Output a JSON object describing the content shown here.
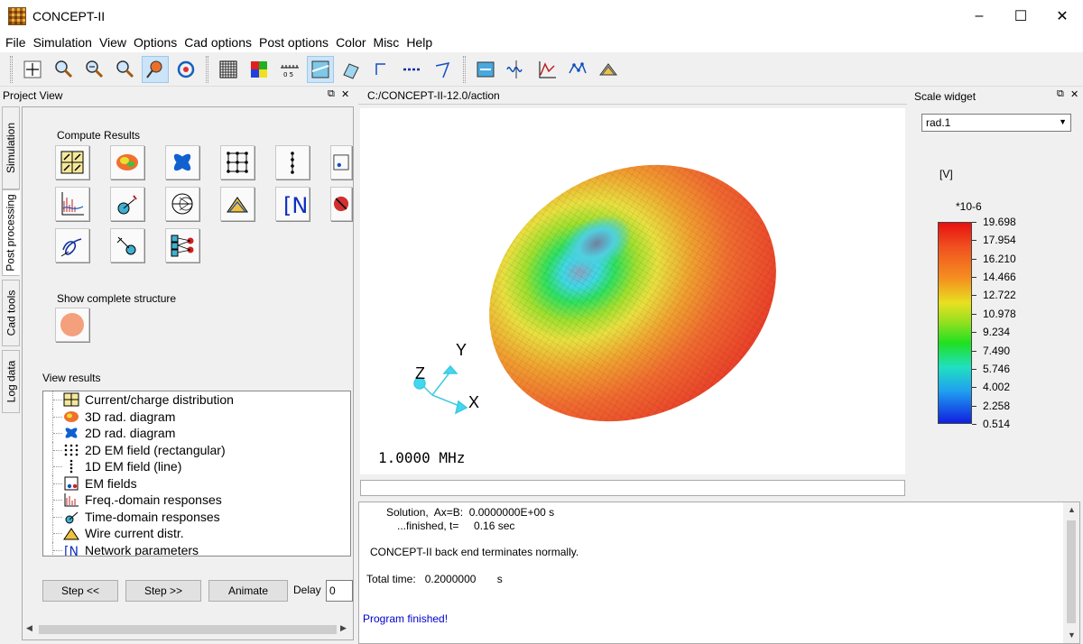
{
  "window": {
    "title": "CONCEPT-II",
    "controls": [
      "–",
      "☐",
      "✕"
    ]
  },
  "menubar": [
    "File",
    "Simulation",
    "View",
    "Options",
    "Cad options",
    "Post options",
    "Color",
    "Misc",
    "Help"
  ],
  "toolbar": {
    "group1": [
      "move-icon",
      "zoom-in-icon",
      "zoom-out-icon",
      "zoom-fit-icon",
      "pin-icon",
      "rotate-icon"
    ],
    "group2": [
      "mesh-icon",
      "color-grid-icon",
      "ruler-icon",
      "surface-icon",
      "plane-icon",
      "wire-icon",
      "dashed-line-icon",
      "corner-icon"
    ],
    "group3": [
      "view-icon",
      "waveform-icon",
      "axes-plot-icon",
      "network-plot-icon",
      "wire-current-icon"
    ]
  },
  "left_panel": {
    "title": "Project View",
    "float_icon": "⧉",
    "close_icon": "✕",
    "tabs": [
      "Simulation",
      "Post processing",
      "Cad tools",
      "Log data"
    ],
    "compute_results_label": "Compute Results",
    "show_structure_label": "Show complete structure",
    "view_results_label": "View results",
    "results": [
      {
        "label": "Current/charge distribution",
        "icon": "current-distribution-icon"
      },
      {
        "label": "3D rad. diagram",
        "icon": "rad-3d-icon"
      },
      {
        "label": "2D rad. diagram",
        "icon": "rad-2d-icon"
      },
      {
        "label": "2D EM field (rectangular)",
        "icon": "em-grid-icon"
      },
      {
        "label": "1D EM field (line)",
        "icon": "em-line-icon"
      },
      {
        "label": "EM fields",
        "icon": "em-fields-icon"
      },
      {
        "label": "Freq.-domain responses",
        "icon": "freq-response-icon"
      },
      {
        "label": "Time-domain responses",
        "icon": "time-response-icon"
      },
      {
        "label": "Wire current distr.",
        "icon": "wire-current-icon"
      },
      {
        "label": "Network parameters",
        "icon": "network-icon"
      }
    ],
    "buttons": {
      "step_back": "Step <<",
      "step_forward": "Step >>",
      "animate": "Animate"
    },
    "delay_label": "Delay",
    "delay_value": "0"
  },
  "center": {
    "path": "C:/CONCEPT-II-12.0/action",
    "frequency": "1.0000 MHz",
    "axes": {
      "x": "X",
      "y": "Y",
      "z": "Z"
    }
  },
  "log": {
    "lines": [
      "Solution,  Ax=B:  0.0000000E+00 s",
      "...finished, t=     0.16 sec",
      "CONCEPT-II back end terminates normally.",
      "Total time:   0.2000000       s",
      "Program finished!"
    ]
  },
  "scale_widget": {
    "title": "Scale widget",
    "float_icon": "⧉",
    "close_icon": "✕",
    "selected": "rad.1",
    "unit": "[V]",
    "exponent": "*10-6",
    "labels": [
      "19.698",
      "17.954",
      "16.210",
      "14.466",
      "12.722",
      "10.978",
      "9.234",
      "7.490",
      "5.746",
      "4.002",
      "2.258",
      "0.514"
    ]
  }
}
